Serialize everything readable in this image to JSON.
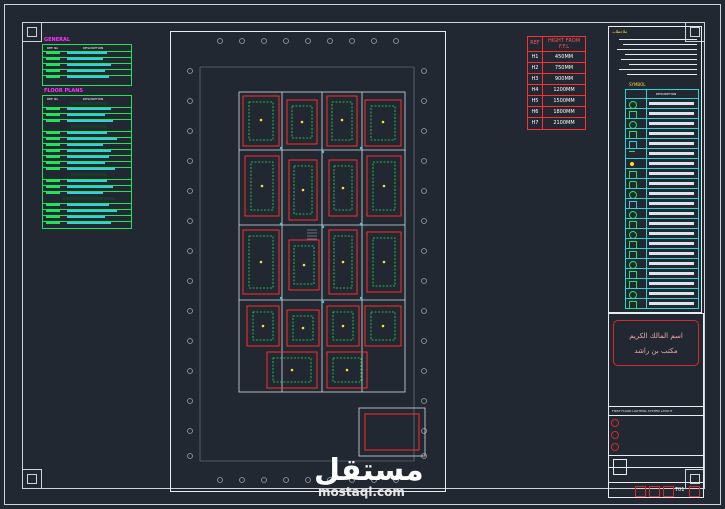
{
  "legend": {
    "general_title": "GENERAL",
    "general_col_ref": "REF. No",
    "general_col_desc": "DESCRIPTION",
    "floor_plans_title": "FLOOR PLANS",
    "floor_plans_col_ref": "REF. No",
    "floor_plans_col_desc": "DESCRIPTION"
  },
  "height_table": {
    "col_ref": "REF",
    "col_height": "HIGHT FROM F.F.L",
    "rows": [
      {
        "ref": "H1",
        "height": "450MM"
      },
      {
        "ref": "H2",
        "height": "750MM"
      },
      {
        "ref": "H3",
        "height": "900MM"
      },
      {
        "ref": "H4",
        "height": "1200MM"
      },
      {
        "ref": "H5",
        "height": "1500MM"
      },
      {
        "ref": "H6",
        "height": "1800MM"
      },
      {
        "ref": "H7",
        "height": "2100MM"
      }
    ]
  },
  "notes": {
    "title": "ملاحظات",
    "symbols_title": "SYMBOL",
    "symbols_col_desc": "DESCRIPTION"
  },
  "stamp": {
    "line1": "اسم المالك الكريم",
    "line2": "مكتب بن راشد"
  },
  "title_block": {
    "drawing_title": "FIRST FLOOR LIGHTING SYSTEM LAYOUT",
    "sheet_no": "T01"
  },
  "watermark": {
    "brand": "مستقل",
    "domain": "mostaql.com"
  },
  "colors": {
    "background": "#222831",
    "legend_green": "#1fe35a",
    "height_red": "#ff2d2d",
    "symbol_cyan": "#2dd4d4",
    "heading_magenta": "#ff33ff"
  }
}
